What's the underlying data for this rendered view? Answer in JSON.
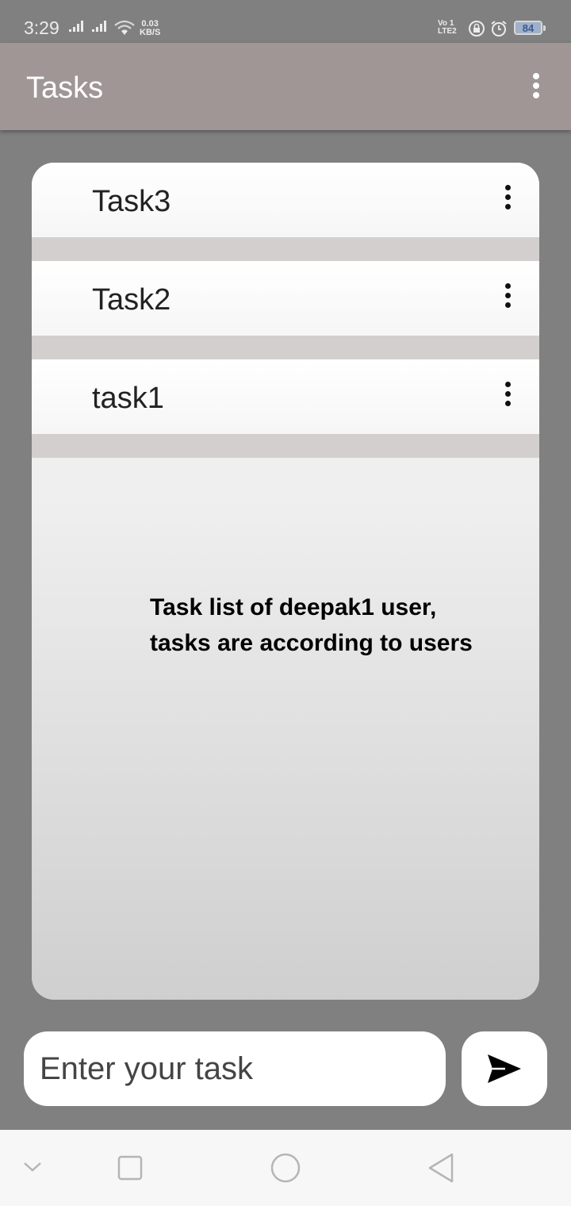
{
  "status_bar": {
    "time": "3:29",
    "net_speed_value": "0.03",
    "net_speed_unit": "KB/S",
    "volte_top": "Vo",
    "volte_bottom": "LTE",
    "sim1": "1",
    "sim2": "2",
    "battery": "84"
  },
  "app_bar": {
    "title": "Tasks",
    "overflow_icon": "more-vert-icon"
  },
  "tasks": [
    {
      "label": "Task3",
      "menu_icon": "more-vert-icon"
    },
    {
      "label": "Task2",
      "menu_icon": "more-vert-icon"
    },
    {
      "label": "task1",
      "menu_icon": "more-vert-icon"
    }
  ],
  "annotation": {
    "line1": "Task list of deepak1 user,",
    "line2": "tasks are according to users"
  },
  "composer": {
    "placeholder": "Enter your task",
    "send_icon": "send-icon"
  },
  "nav_bar": {
    "icons": [
      "chevron-down-icon",
      "square-recents-icon",
      "circle-home-icon",
      "triangle-back-icon"
    ]
  }
}
